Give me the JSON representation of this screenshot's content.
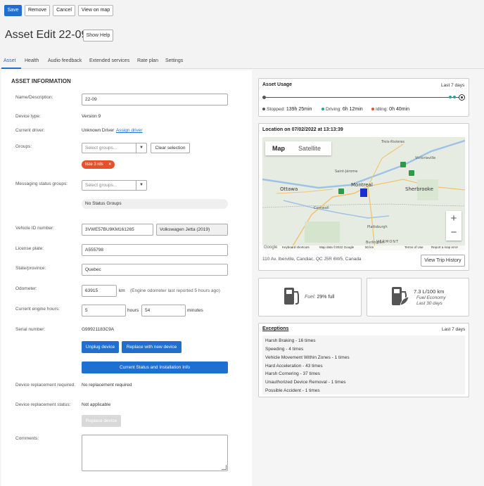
{
  "toolbar": {
    "save": "Save",
    "remove": "Remove",
    "cancel": "Cancel",
    "view_on_map": "View on map"
  },
  "page": {
    "title": "Asset Edit 22-09",
    "help_button": "Show Help"
  },
  "tabs": [
    "Asset",
    "Health",
    "Audio feedback",
    "Extended services",
    "Rate plan",
    "Settings"
  ],
  "active_tab": "Asset",
  "form": {
    "section_title": "ASSET INFORMATION",
    "name_label": "Name/Description:",
    "name_value": "22-09",
    "device_type_label": "Device type:",
    "device_type_value": "Version 9",
    "driver_label": "Current driver:",
    "driver_value": "Unknown Driver",
    "assign_driver": "Assign driver",
    "groups_label": "Groups:",
    "groups_placeholder": "Select groups...",
    "clear_selection": "Clear selection",
    "group_chip": "liste 3 rds",
    "messaging_label": "Messaging status groups:",
    "messaging_placeholder": "Select groups...",
    "no_status_groups": "No Status Groups",
    "vin_label": "Vehicle ID number:",
    "vin_value": "3VWE57BU9KM161265",
    "vehicle_model": "Volkswagen Jetta (2019)",
    "plate_label": "License plate:",
    "plate_value": "A555798",
    "state_label": "State/province:",
    "state_value": "Quebec",
    "odometer_label": "Odometer:",
    "odometer_value": "63915",
    "odometer_unit": "km",
    "odometer_note": "(Engine odometer last reported 5 hours ago)",
    "engine_hours_label": "Current engine hours:",
    "engine_hours_value": "5",
    "hours_unit": "hours",
    "engine_minutes_value": "54",
    "minutes_unit": "minutes",
    "serial_label": "Serial number:",
    "serial_value": "G99921183C9A",
    "unplug_button": "Unplug device",
    "replace_button": "Replace with new device",
    "status_button": "Current Status and Installation Info",
    "replacement_required_label": "Device replacement required:",
    "replacement_required_value": "No replacement required",
    "replacement_status_label": "Device replacement status:",
    "replacement_status_value": "Not applicable",
    "replace_device_button": "Replace device",
    "comments_label": "Comments:"
  },
  "usage": {
    "title": "Asset Usage",
    "period": "Last 7 days",
    "stopped_label": "Stopped:",
    "stopped_value": "139h 25min",
    "driving_label": "Driving:",
    "driving_value": "6h 12min",
    "idling_label": "Idling:",
    "idling_value": "0h 40min",
    "colors": {
      "stopped": "#555555",
      "driving": "#2aa198",
      "idling": "#e8502c"
    }
  },
  "location": {
    "title": "Location on 07/02/2022 at 13:13:39",
    "map_tab": "Map",
    "satellite_tab": "Satellite",
    "cities": [
      "Trois-Rivieres",
      "Victoriaville",
      "Saint-Jérome",
      "Montreal",
      "Ottawa",
      "Sherbrooke",
      "Cornwall",
      "Plattsburgh",
      "Burlington",
      "VERMONT"
    ],
    "footer": {
      "google": "Google",
      "shortcuts": "Keyboard shortcuts",
      "map_data": "Map data ©2022 Google",
      "scale": "50 km",
      "terms": "Terms of Use",
      "report": "Report a map error"
    },
    "address": "110 Av. Iberville, Candiac, QC J5R 6W5, Canada",
    "history_button": "View Trip History"
  },
  "fuel": {
    "label": "Fuel:",
    "value": "29% full"
  },
  "economy": {
    "value": "7.3 L/100 km",
    "label": "Fuel Economy",
    "period": "Last 30 days"
  },
  "exceptions": {
    "title": "Exceptions",
    "period": "Last 7 days",
    "items": [
      "Harsh Braking - 16 times",
      "Speeding - 4 times",
      "Vehicle Movement Within Zones - 1 times",
      "Hard Acceleration - 43 times",
      "Harsh Cornering - 37 times",
      "Unauthorized Device Removal - 1 times",
      "Possible Accident - 1 times"
    ]
  }
}
